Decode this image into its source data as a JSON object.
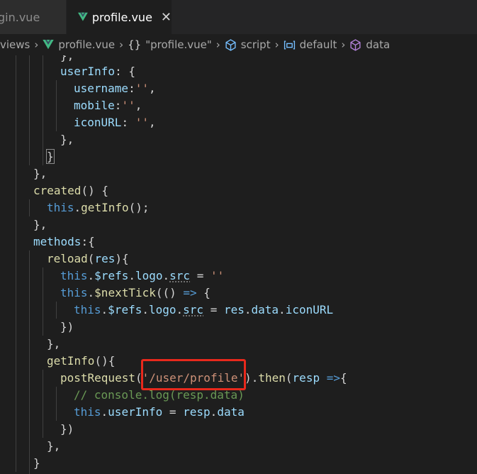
{
  "tabs": [
    {
      "label": "gin.vue",
      "active": false
    },
    {
      "label": "profile.vue",
      "active": true,
      "close_icon": "close-icon"
    }
  ],
  "breadcrumb": {
    "folder": "views",
    "file": "profile.vue",
    "braces": "{}",
    "module": "\"profile.vue\"",
    "script": "script",
    "default": "default",
    "data": "data"
  },
  "colors": {
    "editor_bg": "#1e1e1e",
    "tab_bg": "#252526",
    "vue_green": "#42b883",
    "highlight_red": "#e8291c"
  },
  "code": [
    [
      {
        "t": "},",
        "c": "pl"
      }
    ],
    [
      {
        "t": "userInfo",
        "c": "pr"
      },
      {
        "t": ": {",
        "c": "pl"
      }
    ],
    [
      {
        "t": "username",
        "c": "pr"
      },
      {
        "t": ":",
        "c": "pl"
      },
      {
        "t": "''",
        "c": "st"
      },
      {
        "t": ",",
        "c": "pl"
      }
    ],
    [
      {
        "t": "mobile",
        "c": "pr"
      },
      {
        "t": ":",
        "c": "pl"
      },
      {
        "t": "''",
        "c": "st"
      },
      {
        "t": ",",
        "c": "pl"
      }
    ],
    [
      {
        "t": "iconURL",
        "c": "pr"
      },
      {
        "t": ": ",
        "c": "pl"
      },
      {
        "t": "''",
        "c": "st"
      },
      {
        "t": ",",
        "c": "pl"
      }
    ],
    [
      {
        "t": "},",
        "c": "pl"
      }
    ],
    [
      {
        "t": "}",
        "c": "br box"
      }
    ],
    [
      {
        "t": "},",
        "c": "pl"
      }
    ],
    [
      {
        "t": "created",
        "c": "fn"
      },
      {
        "t": "() {",
        "c": "pl"
      }
    ],
    [
      {
        "t": "this",
        "c": "kw"
      },
      {
        "t": ".",
        "c": "pl"
      },
      {
        "t": "getInfo",
        "c": "fn"
      },
      {
        "t": "();",
        "c": "pl"
      }
    ],
    [
      {
        "t": "},",
        "c": "pl"
      }
    ],
    [
      {
        "t": "methods",
        "c": "pr"
      },
      {
        "t": ":{",
        "c": "pl"
      }
    ],
    [
      {
        "t": "reload",
        "c": "fn"
      },
      {
        "t": "(",
        "c": "pl"
      },
      {
        "t": "res",
        "c": "pr"
      },
      {
        "t": "){",
        "c": "pl"
      }
    ],
    [
      {
        "t": "this",
        "c": "kw"
      },
      {
        "t": ".",
        "c": "pl"
      },
      {
        "t": "$refs",
        "c": "pr"
      },
      {
        "t": ".",
        "c": "pl"
      },
      {
        "t": "logo",
        "c": "pr"
      },
      {
        "t": ".",
        "c": "pl"
      },
      {
        "t": "src",
        "c": "pr squig"
      },
      {
        "t": " = ",
        "c": "pl"
      },
      {
        "t": "''",
        "c": "st"
      }
    ],
    [
      {
        "t": "this",
        "c": "kw"
      },
      {
        "t": ".",
        "c": "pl"
      },
      {
        "t": "$nextTick",
        "c": "fn"
      },
      {
        "t": "(() ",
        "c": "pl"
      },
      {
        "t": "=>",
        "c": "kw"
      },
      {
        "t": " {",
        "c": "pl"
      }
    ],
    [
      {
        "t": "this",
        "c": "kw"
      },
      {
        "t": ".",
        "c": "pl"
      },
      {
        "t": "$refs",
        "c": "pr"
      },
      {
        "t": ".",
        "c": "pl"
      },
      {
        "t": "logo",
        "c": "pr"
      },
      {
        "t": ".",
        "c": "pl"
      },
      {
        "t": "src",
        "c": "pr squig"
      },
      {
        "t": " = ",
        "c": "pl"
      },
      {
        "t": "res",
        "c": "pr"
      },
      {
        "t": ".",
        "c": "pl"
      },
      {
        "t": "data",
        "c": "pr"
      },
      {
        "t": ".",
        "c": "pl"
      },
      {
        "t": "iconURL",
        "c": "pr"
      }
    ],
    [
      {
        "t": "})",
        "c": "pl"
      }
    ],
    [
      {
        "t": "},",
        "c": "pl"
      }
    ],
    [
      {
        "t": "getInfo",
        "c": "fn"
      },
      {
        "t": "(){",
        "c": "pl"
      }
    ],
    [
      {
        "t": "postRequest",
        "c": "fn"
      },
      {
        "t": "(",
        "c": "pl"
      },
      {
        "t": "'/user/profile'",
        "c": "st"
      },
      {
        "t": ").",
        "c": "pl"
      },
      {
        "t": "then",
        "c": "fn"
      },
      {
        "t": "(",
        "c": "pl"
      },
      {
        "t": "resp",
        "c": "pr"
      },
      {
        "t": " ",
        "c": "pl"
      },
      {
        "t": "=>",
        "c": "kw"
      },
      {
        "t": "{",
        "c": "pl"
      }
    ],
    [
      {
        "t": "// console.log(resp.data)",
        "c": "cm"
      }
    ],
    [
      {
        "t": "this",
        "c": "kw"
      },
      {
        "t": ".",
        "c": "pl"
      },
      {
        "t": "userInfo",
        "c": "pr"
      },
      {
        "t": " = ",
        "c": "pl"
      },
      {
        "t": "resp",
        "c": "pr"
      },
      {
        "t": ".",
        "c": "pl"
      },
      {
        "t": "data",
        "c": "pr"
      }
    ],
    [
      {
        "t": "})",
        "c": "pl"
      }
    ],
    [
      {
        "t": "},",
        "c": "pl"
      }
    ],
    [
      {
        "t": "}",
        "c": "pl"
      }
    ],
    [
      {
        "t": "}",
        "c": "pl"
      }
    ]
  ]
}
